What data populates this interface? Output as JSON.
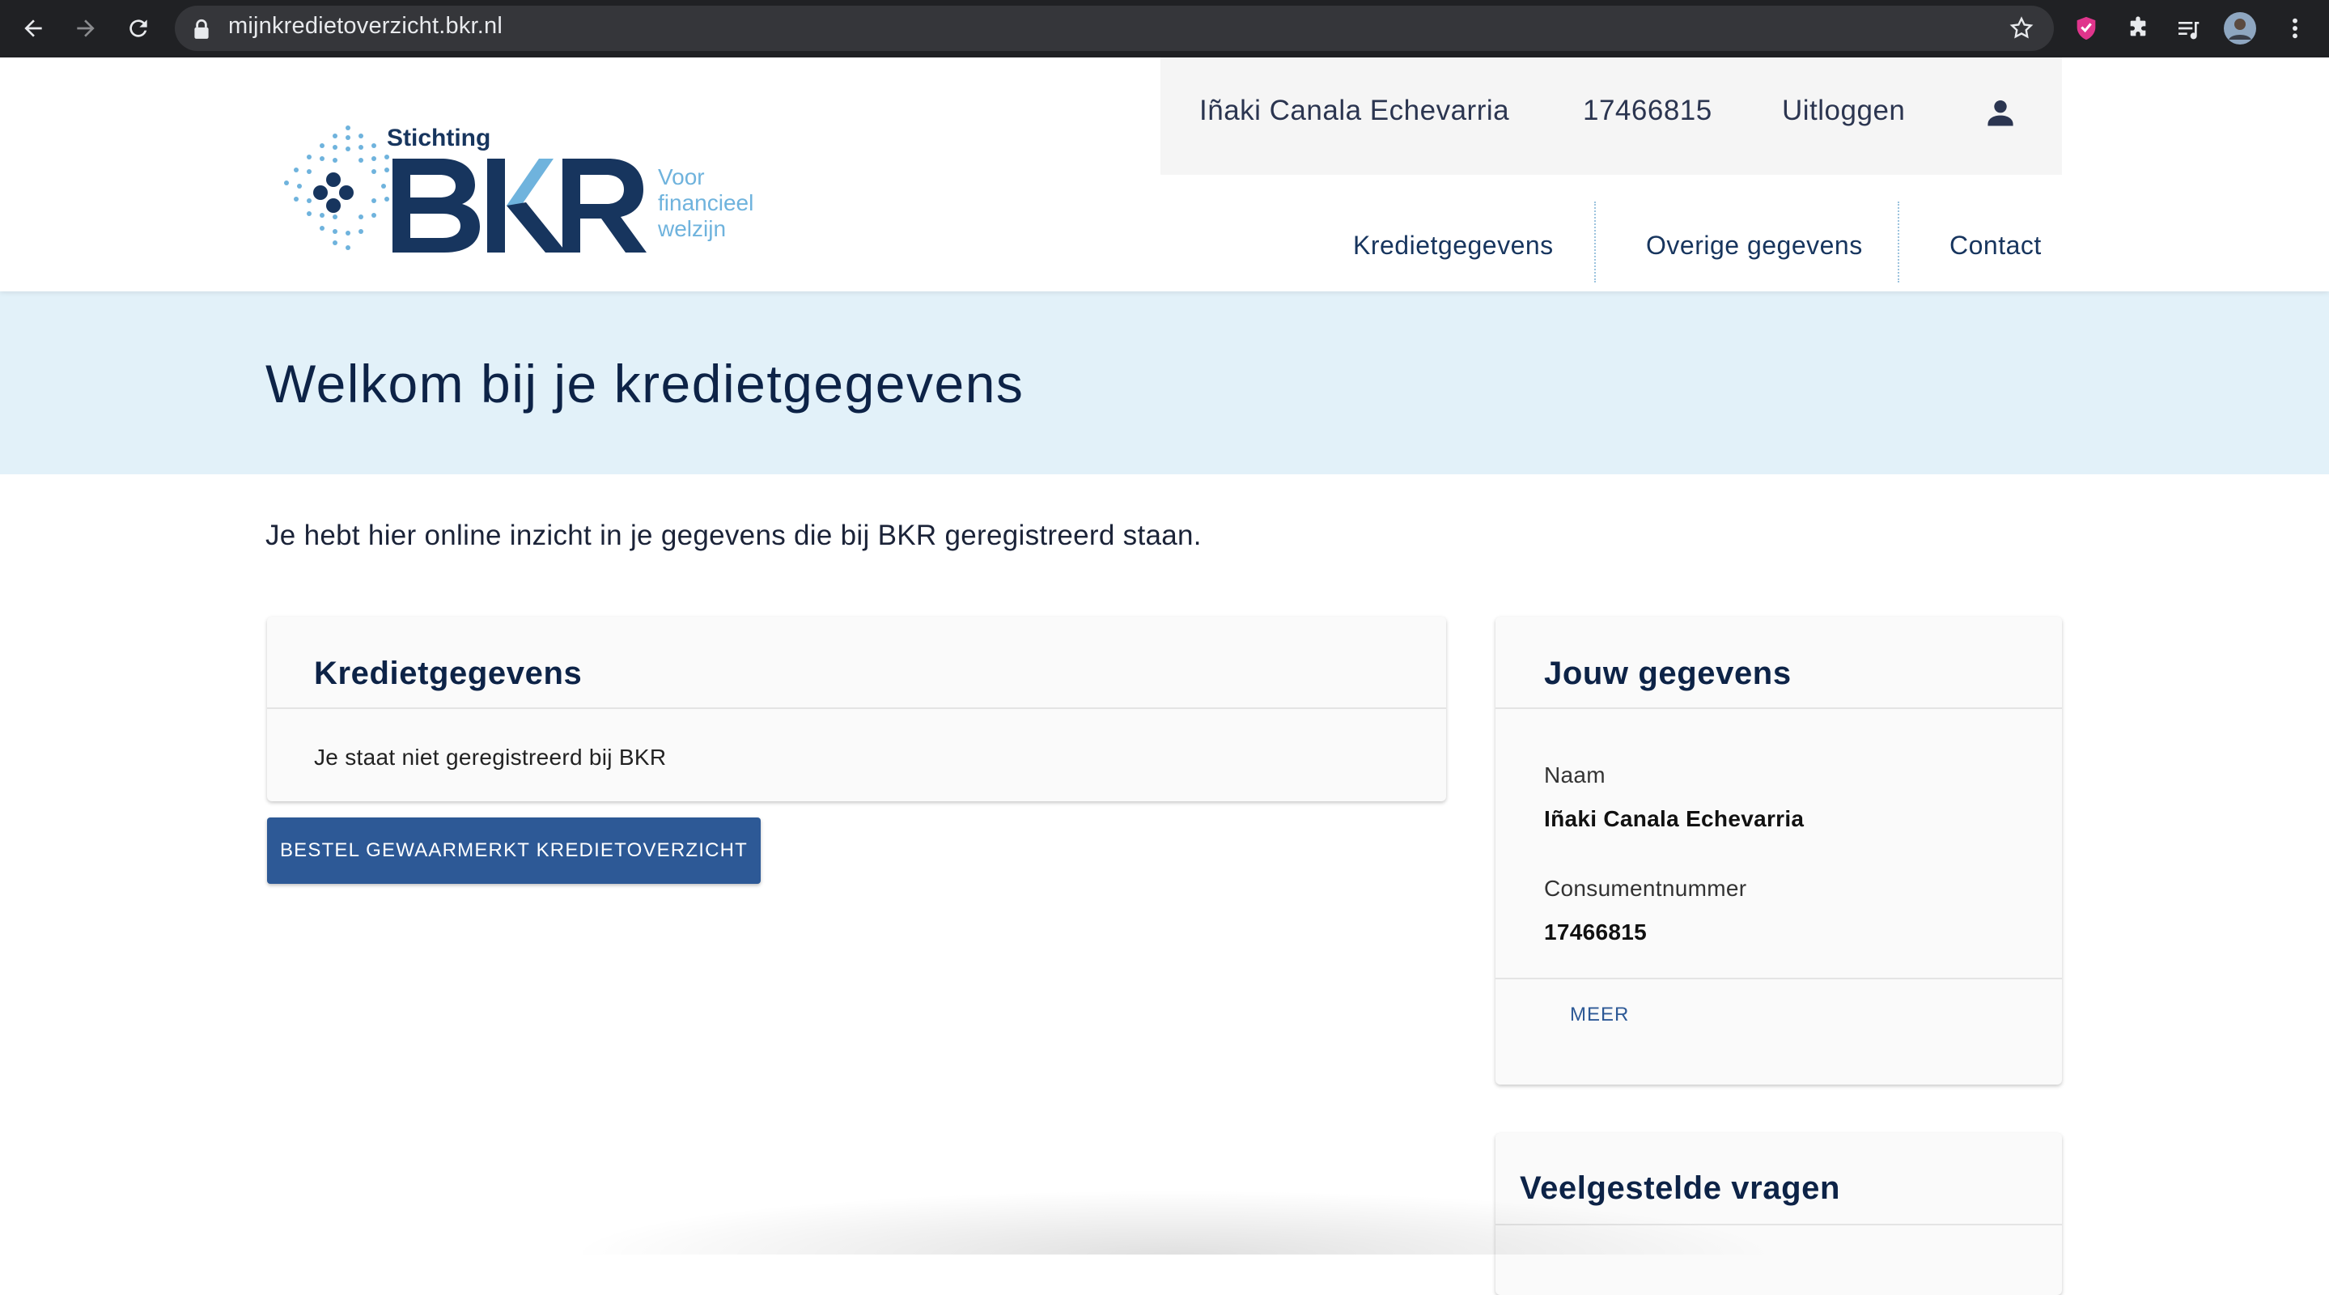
{
  "browser": {
    "url": "mijnkredietoverzicht.bkr.nl"
  },
  "logo": {
    "top_word": "Stichting",
    "brand": "BKR",
    "tagline_1": "Voor",
    "tagline_2": "financieel",
    "tagline_3": "welzijn"
  },
  "userbar": {
    "name": "Iñaki Canala Echevarria",
    "consumer_number": "17466815",
    "logout": "Uitloggen"
  },
  "nav": {
    "items": [
      "Kredietgegevens",
      "Overige gegevens",
      "Contact"
    ]
  },
  "hero": {
    "title": "Welkom bij je kredietgegevens"
  },
  "intro": "Je hebt hier online inzicht in je gegevens die bij BKR geregistreerd staan.",
  "credit_card": {
    "title": "Kredietgegevens",
    "status": "Je staat niet geregistreerd bij BKR",
    "button": "BESTEL GEWAARMERKT KREDIETOVERZICHT"
  },
  "profile_card": {
    "title": "Jouw gegevens",
    "name_label": "Naam",
    "name_value": "Iñaki Canala Echevarria",
    "number_label": "Consumentnummer",
    "number_value": "17466815",
    "more": "MEER"
  },
  "faq_card": {
    "title": "Veelgestelde vragen"
  },
  "colors": {
    "brand_navy": "#17355e",
    "brand_light_blue": "#6fb3dd",
    "hero_background": "#e2f1f9",
    "button_blue": "#2d5996"
  }
}
